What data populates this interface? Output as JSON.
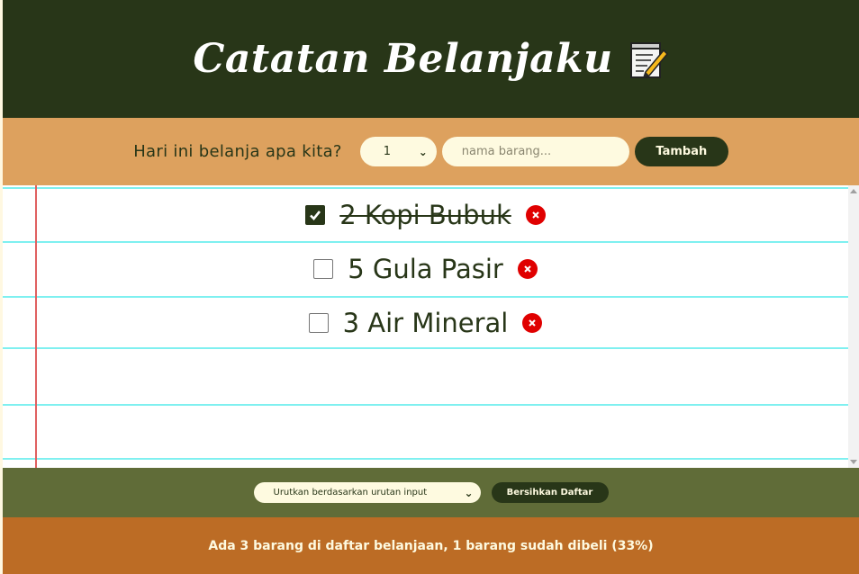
{
  "header": {
    "title": "Catatan Belanjaku",
    "icon": "memo-icon"
  },
  "form": {
    "prompt": "Hari ini belanja apa kita?",
    "quantity_selected": "1",
    "name_placeholder": "nama barang...",
    "add_label": "Tambah"
  },
  "items": [
    {
      "label": "2 Kopi Bubuk",
      "packed": true
    },
    {
      "label": "5 Gula Pasir",
      "packed": false
    },
    {
      "label": "3 Air Mineral",
      "packed": false
    }
  ],
  "actions": {
    "sort_selected": "Urutkan berdasarkan urutan input",
    "clear_label": "Bersihkan Daftar"
  },
  "footer": {
    "stats": "Ada 3 barang di daftar belanjaan, 1 barang sudah dibeli (33%)"
  },
  "colors": {
    "dark_green": "#283618",
    "olive": "#606c38",
    "cream": "#fefae0",
    "tan": "#dda15e",
    "brown": "#bc6c25",
    "delete_red": "#e00000"
  }
}
